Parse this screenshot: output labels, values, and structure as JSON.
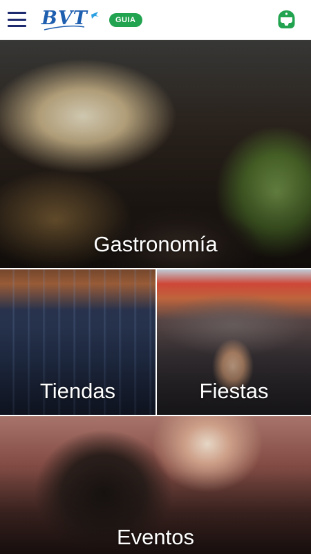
{
  "header": {
    "logo_text": "BVT",
    "badge_label": "GUIA"
  },
  "colors": {
    "brand_navy": "#1d2a6e",
    "logo_blue": "#1f5fb0",
    "badge_green": "#22a34f"
  },
  "icons": {
    "menu": "hamburger-menu-icon",
    "profile": "helmet-icon"
  },
  "tiles": [
    {
      "label": "Gastronomía"
    },
    {
      "label": "Tiendas"
    },
    {
      "label": "Fiestas"
    },
    {
      "label": "Eventos"
    }
  ]
}
